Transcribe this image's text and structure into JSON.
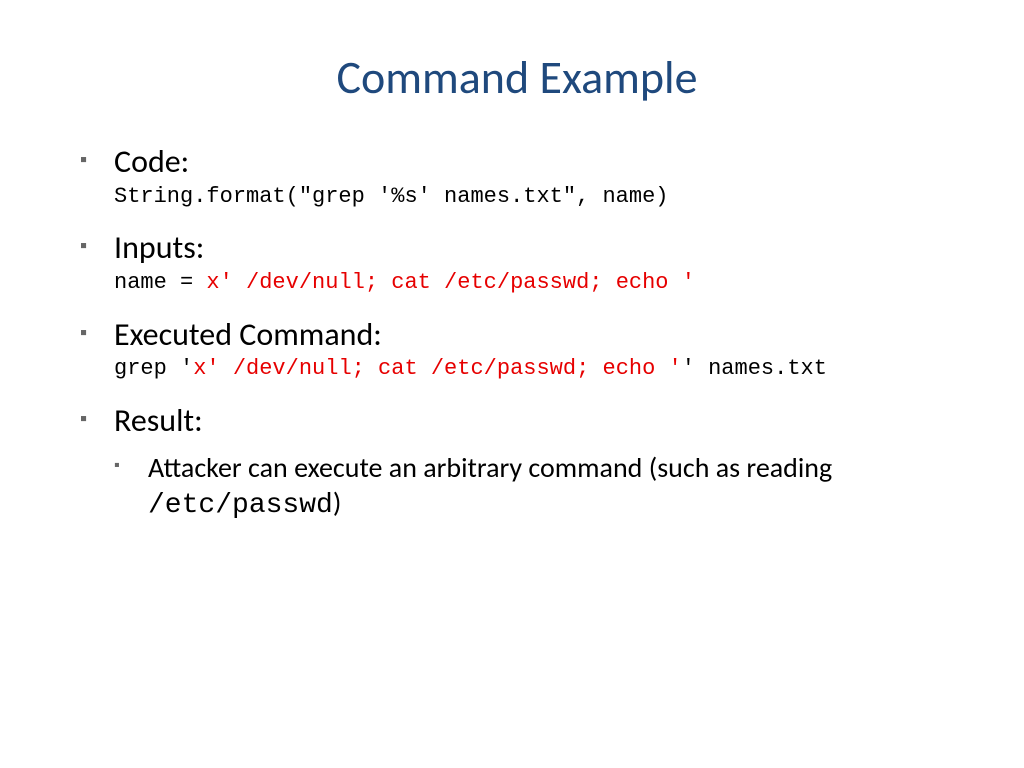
{
  "title": "Command Example",
  "items": {
    "code": {
      "heading": "Code:",
      "line": "String.format(\"grep '%s' names.txt\", name)"
    },
    "inputs": {
      "heading": "Inputs:",
      "prefix": "name = ",
      "red": "x' /dev/null; cat /etc/passwd; echo '"
    },
    "executed": {
      "heading": "Executed Command:",
      "before": "grep '",
      "red": "x' /dev/null; cat /etc/passwd; echo '",
      "after": "' names.txt"
    },
    "result": {
      "heading": "Result:",
      "sub": {
        "before": "Attacker can execute an arbitrary command (such as reading ",
        "mono": "/etc/passwd",
        "after": ")"
      }
    }
  }
}
